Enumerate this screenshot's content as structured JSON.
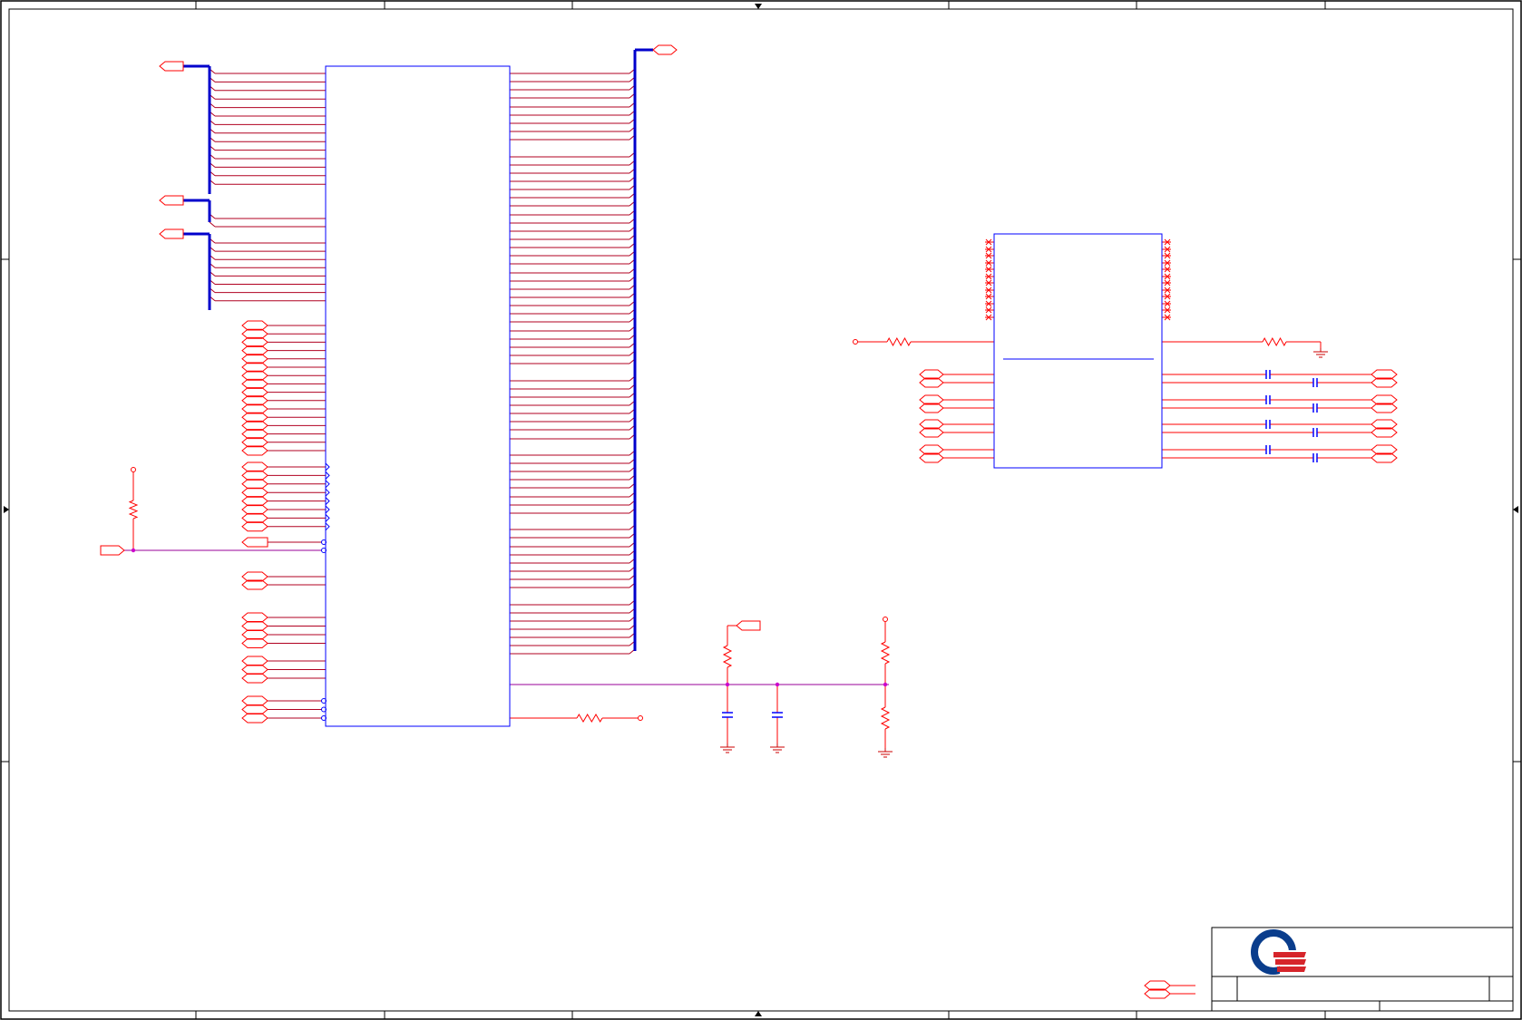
{
  "colors": {
    "border": "#000000",
    "component": "#0000ff",
    "bus": "#0000cc",
    "wire": "#b00020",
    "signal": "#ff0000",
    "junction": "#cc00cc",
    "net_horizontal": "#990099",
    "logo_blue": "#0a3d8c",
    "logo_red": "#d6252b"
  },
  "icons": {
    "logo": "company-logo-q-icon",
    "ground": "ground-icon",
    "resistor": "resistor-icon",
    "capacitor": "capacitor-icon",
    "power": "power-pin-icon",
    "no_connect": "no-connect-icon",
    "offpage": "offpage-connector-icon"
  }
}
